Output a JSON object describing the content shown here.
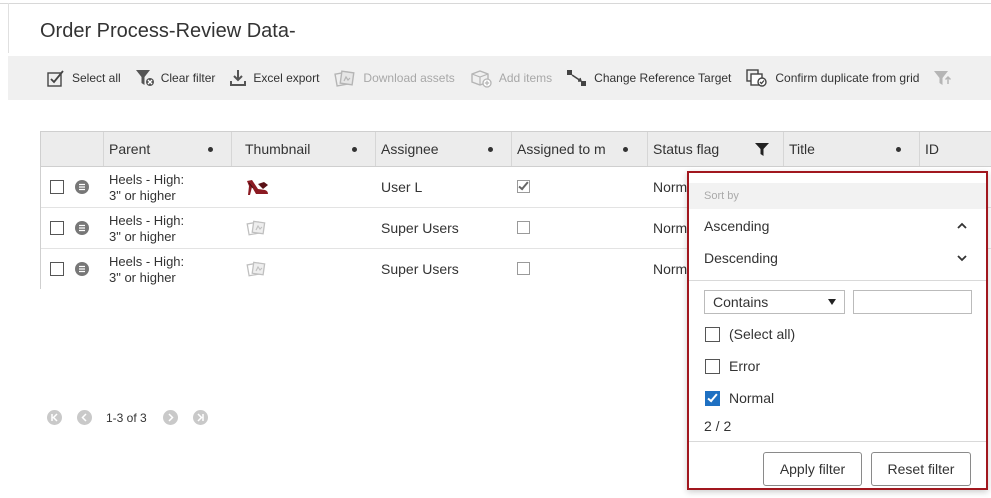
{
  "page": {
    "title": "Order Process-Review Data-"
  },
  "toolbar": {
    "select_all": "Select all",
    "clear_filter": "Clear filter",
    "excel_export": "Excel export",
    "download_assets": "Download assets",
    "add_items": "Add items",
    "change_reference_target": "Change Reference Target",
    "confirm_duplicate": "Confirm duplicate from grid"
  },
  "grid": {
    "columns": [
      "Parent",
      "Thumbnail",
      "Assignee",
      "Assigned to m",
      "Status flag",
      "Title",
      "ID"
    ],
    "rows": [
      {
        "parent_line1": "Heels - High:",
        "parent_line2": "3\" or higher",
        "assignee": "User L",
        "assigned_to_me": true,
        "status": "Norm"
      },
      {
        "parent_line1": "Heels - High:",
        "parent_line2": "3\" or higher",
        "assignee": "Super Users",
        "assigned_to_me": false,
        "status": "Norm"
      },
      {
        "parent_line1": "Heels - High:",
        "parent_line2": "3\" or higher",
        "assignee": "Super Users",
        "assigned_to_me": false,
        "status": "Norm"
      }
    ]
  },
  "pager": {
    "range_text": "1-3 of 3"
  },
  "filter_popup": {
    "sort_by": "Sort by",
    "ascending": "Ascending",
    "descending": "Descending",
    "condition": "Contains",
    "input_value": "",
    "options": [
      {
        "label": "(Select all)",
        "checked": false
      },
      {
        "label": "Error",
        "checked": false
      },
      {
        "label": "Normal",
        "checked": true
      }
    ],
    "count": "2 / 2",
    "apply_label": "Apply filter",
    "reset_label": "Reset filter"
  },
  "colors": {
    "accent_border": "#a1171e",
    "checkbox_blue": "#1e70c2",
    "toolbar_bg": "#f0f0f0",
    "header_bg": "#ececec"
  }
}
